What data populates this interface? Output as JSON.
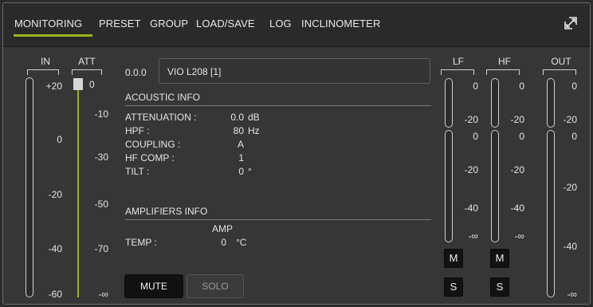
{
  "tabs": [
    {
      "label": "MONITORING",
      "active": true
    },
    {
      "label": "PRESET"
    },
    {
      "label": "GROUP"
    },
    {
      "label": "LOAD/SAVE"
    },
    {
      "label": "LOG"
    },
    {
      "label": "INCLINOMETER"
    }
  ],
  "colors": {
    "accent": "#9ab41e",
    "background": "#363636",
    "button_dark": "#121212"
  },
  "icons": {
    "expand": "expand-icon"
  },
  "in_meter": {
    "label": "IN",
    "scale": [
      "+20",
      "0",
      "-20",
      "-40",
      "-60"
    ]
  },
  "att_meter": {
    "label": "ATT",
    "scale": [
      "0",
      "-10",
      "-30",
      "-50",
      "-70",
      "-∞"
    ]
  },
  "device": {
    "id": "0.0.0",
    "name": "VIO L208 [1]"
  },
  "acoustic": {
    "title": "ACOUSTIC INFO",
    "rows": [
      {
        "label": "ATTENUATION :",
        "value": "0.0",
        "unit": "dB"
      },
      {
        "label": "HPF :",
        "value": "80",
        "unit": "Hz"
      },
      {
        "label": "COUPLING :",
        "value": "A",
        "unit": ""
      },
      {
        "label": "HF COMP :",
        "value": "1",
        "unit": ""
      },
      {
        "label": "TILT :",
        "value": "0",
        "unit": "°"
      }
    ]
  },
  "amplifiers": {
    "title": "AMPLIFIERS INFO",
    "col_header": "AMP",
    "temp_label": "TEMP :",
    "temp_value": "0",
    "temp_unit": "°C"
  },
  "buttons": {
    "mute": "MUTE",
    "solo": "SOLO",
    "m": "M",
    "s": "S"
  },
  "lf": {
    "label": "LF",
    "top_scale": [
      "0",
      "-20"
    ],
    "bottom_scale": [
      "0",
      "-20",
      "-40",
      "-∞"
    ]
  },
  "hf": {
    "label": "HF",
    "top_scale": [
      "0",
      "-20"
    ],
    "bottom_scale": [
      "0",
      "-20",
      "-40",
      "-∞"
    ]
  },
  "out": {
    "label": "OUT",
    "top_scale": [
      "0",
      "-20"
    ],
    "bottom_scale": [
      "0",
      "-20",
      "-40",
      "-∞"
    ]
  }
}
